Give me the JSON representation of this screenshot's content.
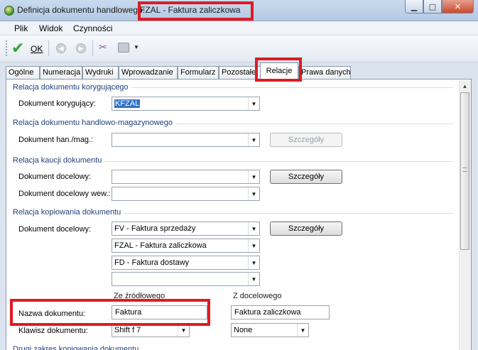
{
  "window": {
    "title_prefix": "Definicja dokumentu handlowego:",
    "title_rest": "FZAL - Faktura zaliczkowa"
  },
  "menu": {
    "file": "Plik",
    "view": "Widok",
    "actions": "Czynności"
  },
  "toolbar": {
    "ok_label": "OK"
  },
  "tabs": [
    {
      "label": "Ogólne"
    },
    {
      "label": "Numeracja"
    },
    {
      "label": "Wydruki"
    },
    {
      "label": "Wprowadzanie"
    },
    {
      "label": "Formularz"
    },
    {
      "label": "Pozostałe"
    },
    {
      "label": "Relacje"
    },
    {
      "label": "Prawa danych"
    }
  ],
  "active_tab": "Relacje",
  "sections": {
    "corrective": {
      "title": "Relacja dokumentu korygującego",
      "doc_label": "Dokument korygujący:",
      "doc_value": "KFZAL"
    },
    "trade": {
      "title": "Relacja dokumentu handlowo-magazynowego",
      "doc_label": "Dokument han./mag.:",
      "doc_value": "",
      "details_button": "Szczegóły"
    },
    "deposit": {
      "title": "Relacja kaucji dokumentu",
      "target_label": "Dokument docelowy:",
      "target_value": "",
      "details_button": "Szczegóły",
      "internal_label": "Dokument docelowy wew.:",
      "internal_value": ""
    },
    "copy": {
      "title": "Relacja kopiowania dokumentu",
      "target_label": "Dokument docelowy:",
      "targets": [
        "FV - Faktura sprzedaży",
        "FZAL - Faktura zaliczkowa",
        "FD - Faktura dostawy",
        ""
      ],
      "details_button": "Szczegóły",
      "from_source_header": "Ze źródłowego",
      "to_target_header": "Z docelowego",
      "doc_name_label": "Nazwa dokumentu:",
      "doc_name_source": "Faktura",
      "doc_name_target": "Faktura zaliczkowa",
      "doc_key_label": "Klawisz dokumentu:",
      "doc_key_source": "Shift f 7",
      "doc_key_target": "None"
    },
    "next_partial_title": "Drugi zakres kopiowania dokumentu"
  },
  "colors": {
    "highlight": "#e01a22",
    "section_title": "#24407c",
    "selection": "#3372c6"
  }
}
